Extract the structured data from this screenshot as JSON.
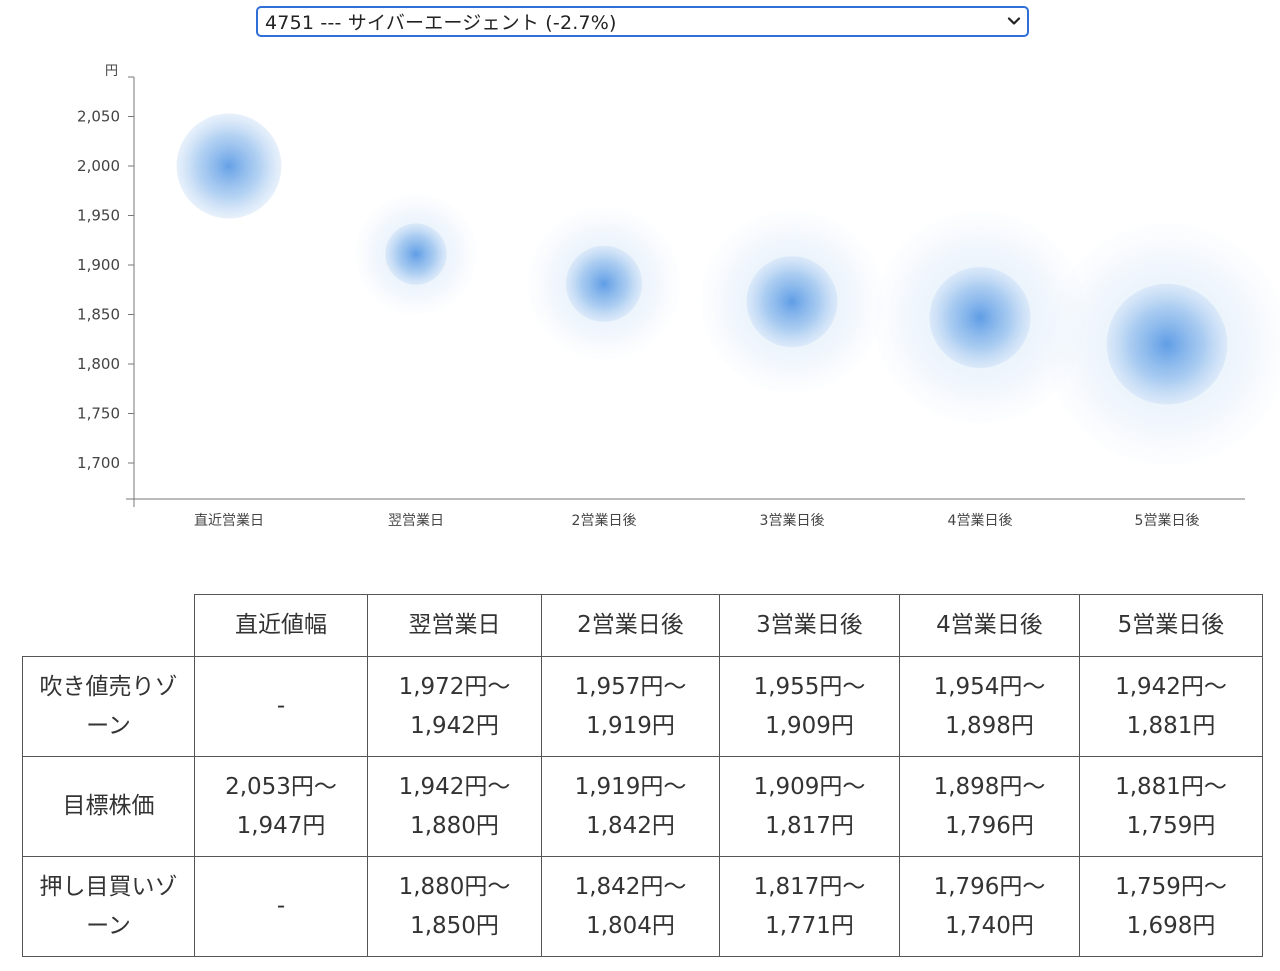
{
  "selector": {
    "selected": "4751 --- サイバーエージェント (-2.7%)"
  },
  "chart_data": {
    "type": "bubble-range",
    "ylabel": "円",
    "ylim": [
      1660,
      2090
    ],
    "yticks": [
      1700,
      1750,
      1800,
      1850,
      1900,
      1950,
      2000,
      2050
    ],
    "ytick_labels": [
      "1,700",
      "1,750",
      "1,800",
      "1,850",
      "1,900",
      "1,950",
      "2,000",
      "2,050"
    ],
    "categories": [
      "直近営業日",
      "翌営業日",
      "2営業日後",
      "3営業日後",
      "4営業日後",
      "5営業日後"
    ],
    "center": [
      2000,
      1911,
      1881,
      1863,
      1847,
      1820
    ],
    "target_high": [
      2053,
      1942,
      1919,
      1909,
      1898,
      1881
    ],
    "target_low": [
      1947,
      1880,
      1842,
      1817,
      1796,
      1759
    ],
    "sell_high": [
      null,
      1972,
      1957,
      1955,
      1954,
      1942
    ],
    "buy_low": [
      null,
      1850,
      1804,
      1771,
      1740,
      1698
    ],
    "colors": {
      "bubble": "#4a90e2",
      "line": "#5b9be0",
      "outer_line": "#aacbed"
    }
  },
  "table": {
    "headers": [
      "直近値幅",
      "翌営業日",
      "2営業日後",
      "3営業日後",
      "4営業日後",
      "5営業日後"
    ],
    "rows": [
      {
        "label": "吹き値売りゾーン",
        "cells": [
          {
            "a": "-",
            "b": ""
          },
          {
            "a": "1,972円〜",
            "b": "1,942円"
          },
          {
            "a": "1,957円〜",
            "b": "1,919円"
          },
          {
            "a": "1,955円〜",
            "b": "1,909円"
          },
          {
            "a": "1,954円〜",
            "b": "1,898円"
          },
          {
            "a": "1,942円〜",
            "b": "1,881円"
          }
        ]
      },
      {
        "label": "目標株価",
        "cells": [
          {
            "a": "2,053円〜",
            "b": "1,947円"
          },
          {
            "a": "1,942円〜",
            "b": "1,880円"
          },
          {
            "a": "1,919円〜",
            "b": "1,842円"
          },
          {
            "a": "1,909円〜",
            "b": "1,817円"
          },
          {
            "a": "1,898円〜",
            "b": "1,796円"
          },
          {
            "a": "1,881円〜",
            "b": "1,759円"
          }
        ]
      },
      {
        "label": "押し目買いゾーン",
        "cells": [
          {
            "a": "-",
            "b": ""
          },
          {
            "a": "1,880円〜",
            "b": "1,850円"
          },
          {
            "a": "1,842円〜",
            "b": "1,804円"
          },
          {
            "a": "1,817円〜",
            "b": "1,771円"
          },
          {
            "a": "1,796円〜",
            "b": "1,740円"
          },
          {
            "a": "1,759円〜",
            "b": "1,698円"
          }
        ]
      }
    ]
  }
}
